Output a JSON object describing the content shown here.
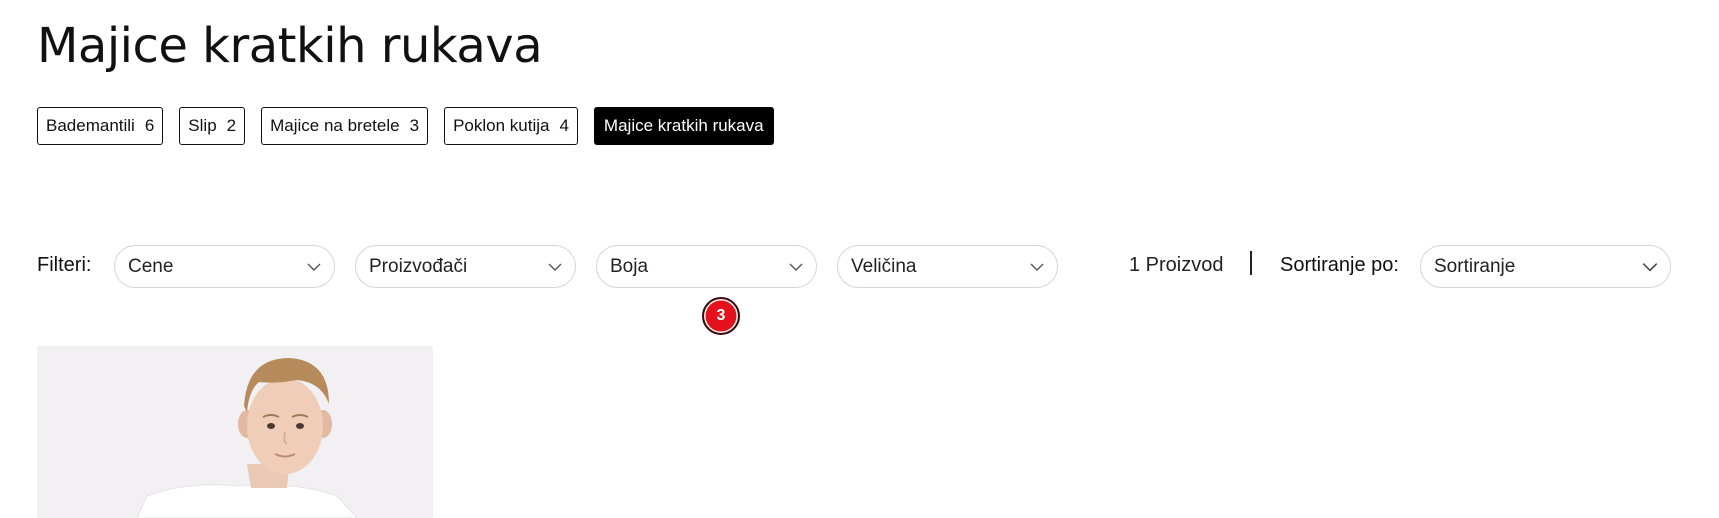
{
  "page": {
    "title": "Majice kratkih rukava"
  },
  "categories": [
    {
      "label": "Bademantili",
      "count": "6"
    },
    {
      "label": "Slip",
      "count": "2"
    },
    {
      "label": "Majice na bretele",
      "count": "3"
    },
    {
      "label": "Poklon kutija",
      "count": "4"
    },
    {
      "label": "Majice kratkih rukava",
      "active": true
    }
  ],
  "filters": {
    "label": "Filteri:",
    "price": "Cene",
    "brand": "Proizvođači",
    "color": "Boja",
    "size": "Veličina",
    "color_badge": "3"
  },
  "results": {
    "count_text": "1 Proizvod"
  },
  "sort": {
    "label": "Sortiranje po:",
    "value": "Sortiranje"
  },
  "colors": {
    "active_chip_bg": "#000000",
    "badge_bg": "#e4101b",
    "border": "#d6d6d6"
  },
  "icons": [
    "chevron-down-icon"
  ],
  "product": {
    "image": "boy in white t-shirt photo"
  }
}
